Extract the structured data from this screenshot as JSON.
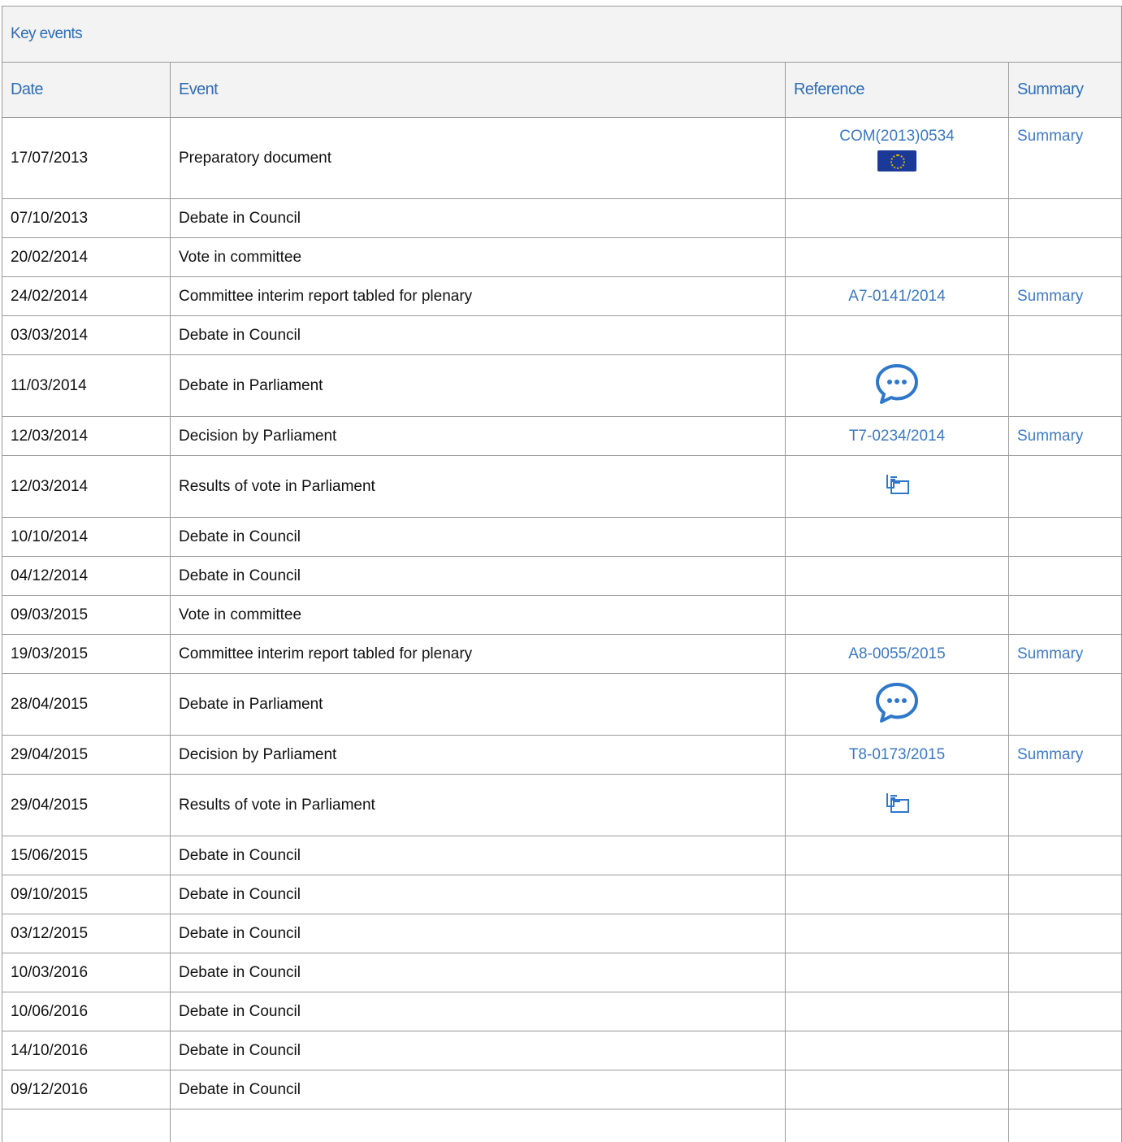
{
  "caption": "Key events",
  "columns": {
    "date": "Date",
    "event": "Event",
    "reference": "Reference",
    "summary": "Summary"
  },
  "colors": {
    "link": "#3b78c0",
    "header_bg": "#f3f3f3",
    "border": "#999999"
  },
  "rows": [
    {
      "date": "17/07/2013",
      "event": "Preparatory document",
      "reference": "COM(2013)0534",
      "ref_icon": "eu-flag-icon",
      "summary": "Summary"
    },
    {
      "date": "07/10/2013",
      "event": "Debate in Council",
      "reference": "",
      "ref_icon": "",
      "summary": ""
    },
    {
      "date": "20/02/2014",
      "event": "Vote in committee",
      "reference": "",
      "ref_icon": "",
      "summary": ""
    },
    {
      "date": "24/02/2014",
      "event": "Committee interim report tabled for plenary",
      "reference": "A7-0141/2014",
      "ref_icon": "",
      "summary": "Summary"
    },
    {
      "date": "03/03/2014",
      "event": "Debate in Council",
      "reference": "",
      "ref_icon": "",
      "summary": ""
    },
    {
      "date": "11/03/2014",
      "event": "Debate in Parliament",
      "reference": "",
      "ref_icon": "chat-bubble-icon",
      "summary": ""
    },
    {
      "date": "12/03/2014",
      "event": "Decision by Parliament",
      "reference": "T7-0234/2014",
      "ref_icon": "",
      "summary": "Summary"
    },
    {
      "date": "12/03/2014",
      "event": "Results of vote in Parliament",
      "reference": "",
      "ref_icon": "ballot-vote-icon",
      "summary": ""
    },
    {
      "date": "10/10/2014",
      "event": "Debate in Council",
      "reference": "",
      "ref_icon": "",
      "summary": ""
    },
    {
      "date": "04/12/2014",
      "event": "Debate in Council",
      "reference": "",
      "ref_icon": "",
      "summary": ""
    },
    {
      "date": "09/03/2015",
      "event": "Vote in committee",
      "reference": "",
      "ref_icon": "",
      "summary": ""
    },
    {
      "date": "19/03/2015",
      "event": "Committee interim report tabled for plenary",
      "reference": "A8-0055/2015",
      "ref_icon": "",
      "summary": "Summary"
    },
    {
      "date": "28/04/2015",
      "event": "Debate in Parliament",
      "reference": "",
      "ref_icon": "chat-bubble-icon",
      "summary": ""
    },
    {
      "date": "29/04/2015",
      "event": "Decision by Parliament",
      "reference": "T8-0173/2015",
      "ref_icon": "",
      "summary": "Summary"
    },
    {
      "date": "29/04/2015",
      "event": "Results of vote in Parliament",
      "reference": "",
      "ref_icon": "ballot-vote-icon",
      "summary": ""
    },
    {
      "date": "15/06/2015",
      "event": "Debate in Council",
      "reference": "",
      "ref_icon": "",
      "summary": ""
    },
    {
      "date": "09/10/2015",
      "event": "Debate in Council",
      "reference": "",
      "ref_icon": "",
      "summary": ""
    },
    {
      "date": "03/12/2015",
      "event": "Debate in Council",
      "reference": "",
      "ref_icon": "",
      "summary": ""
    },
    {
      "date": "10/03/2016",
      "event": "Debate in Council",
      "reference": "",
      "ref_icon": "",
      "summary": ""
    },
    {
      "date": "10/06/2016",
      "event": "Debate in Council",
      "reference": "",
      "ref_icon": "",
      "summary": ""
    },
    {
      "date": "14/10/2016",
      "event": "Debate in Council",
      "reference": "",
      "ref_icon": "",
      "summary": ""
    },
    {
      "date": "09/12/2016",
      "event": "Debate in Council",
      "reference": "",
      "ref_icon": "",
      "summary": ""
    }
  ]
}
